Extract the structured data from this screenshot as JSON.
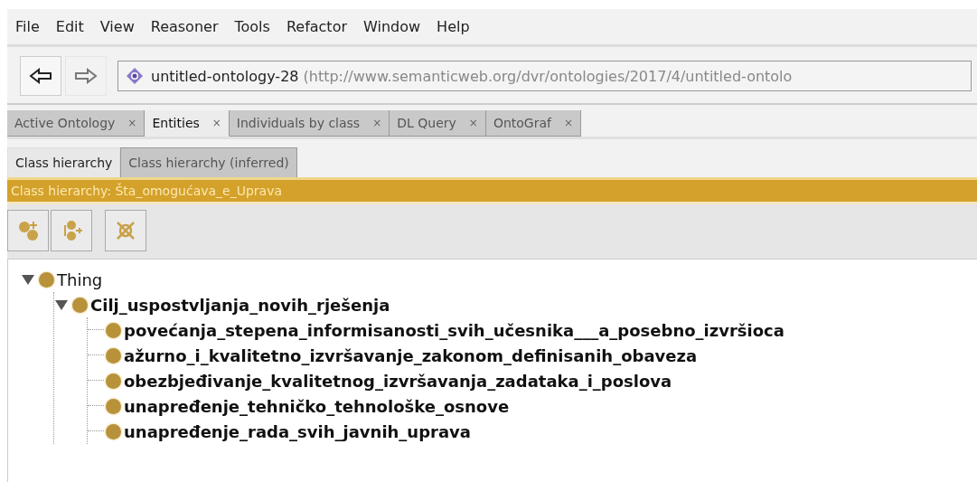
{
  "menu": [
    "File",
    "Edit",
    "View",
    "Reasoner",
    "Tools",
    "Refactor",
    "Window",
    "Help"
  ],
  "address": {
    "name": "untitled-ontology-28",
    "iri": "(http://www.semanticweb.org/dvr/ontologies/2017/4/untitled-ontolo"
  },
  "tabs": [
    {
      "label": "Active Ontology",
      "close": "×",
      "selected": false
    },
    {
      "label": "Entities",
      "close": "×",
      "selected": true
    },
    {
      "label": "Individuals by class",
      "close": "×",
      "selected": false
    },
    {
      "label": "DL Query",
      "close": "×",
      "selected": false
    },
    {
      "label": "OntoGraf",
      "close": "×",
      "selected": false
    }
  ],
  "subtabs": [
    {
      "label": "Class hierarchy",
      "selected": true
    },
    {
      "label": "Class hierarchy (inferred)",
      "selected": false
    }
  ],
  "view_title": "Class hierarchy: Šta_omogućava_e_Uprava",
  "tree": [
    {
      "label": "Thing",
      "bold": false,
      "expanded": true,
      "children": [
        {
          "label": "Cilj_uspostvljanja_novih_rješenja",
          "bold": true,
          "expanded": true,
          "children": [
            {
              "label": "povećanja_stepena_informisanosti_svih_učesnika___a_posebno_izvršioca",
              "bold": true
            },
            {
              "label": "ažurno_i_kvalitetno_izvršavanje_zakonom_definisanih_obaveza",
              "bold": true
            },
            {
              "label": "obezbjeđivanje_kvalitetnog_izvršavanja_zadataka_i_poslova",
              "bold": true
            },
            {
              "label": "unapređenje_tehničko_tehnološke_osnove",
              "bold": true
            },
            {
              "label": "unapređenje_rada_svih_javnih_uprava",
              "bold": true
            }
          ]
        }
      ]
    }
  ]
}
